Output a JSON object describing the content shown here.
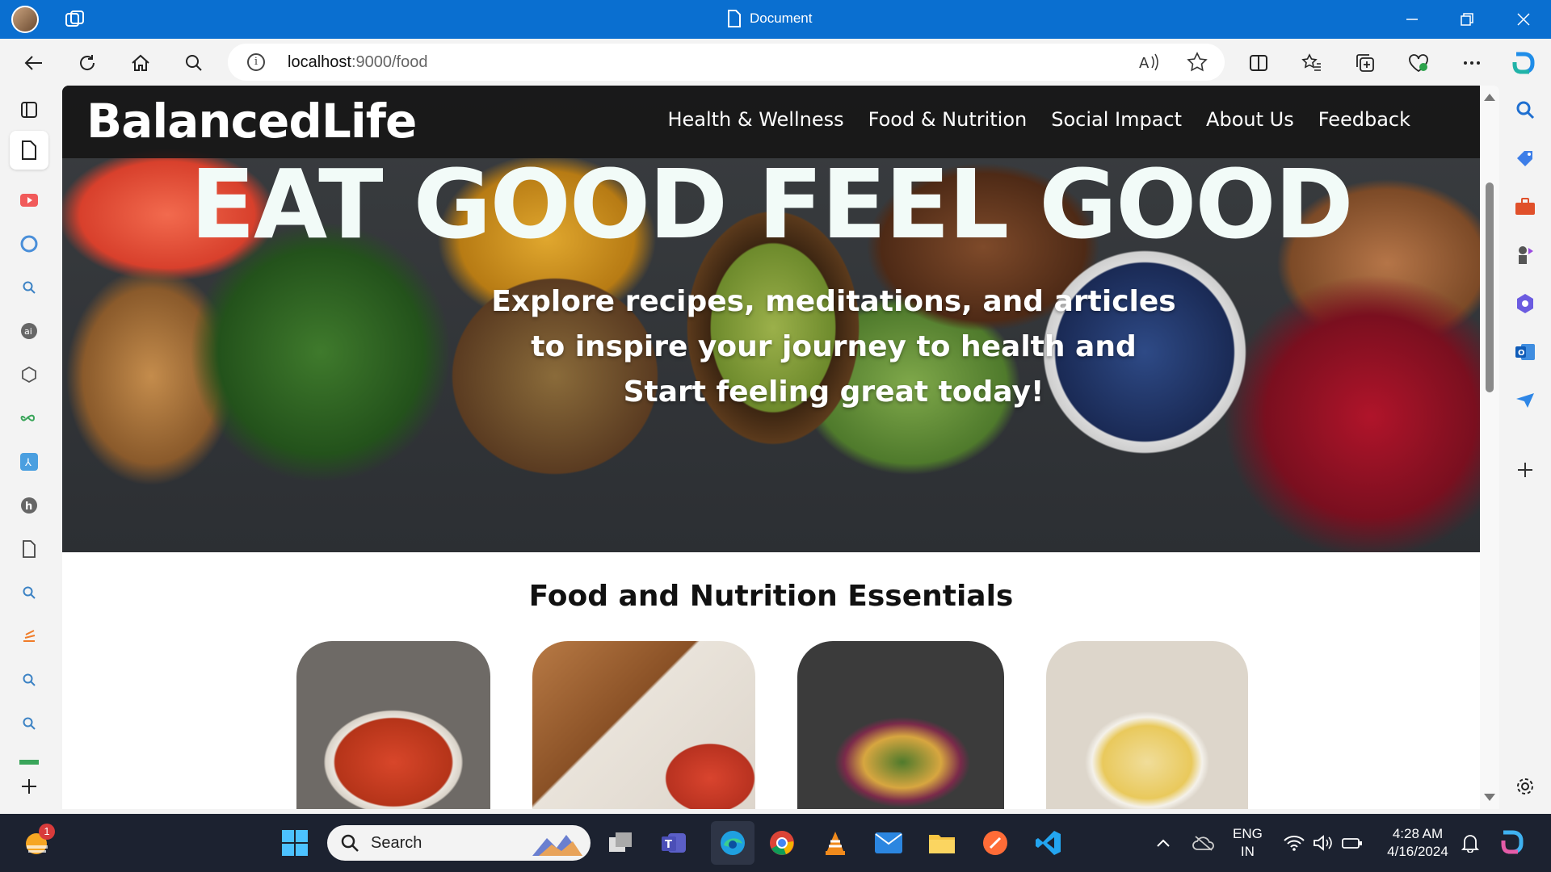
{
  "window": {
    "title": "Document"
  },
  "browser": {
    "url_host": "localhost",
    "url_rest": ":9000/food"
  },
  "site": {
    "logo": "BalancedLife",
    "nav": [
      "Health & Wellness",
      "Food & Nutrition",
      "Social Impact",
      "About Us",
      "Feedback"
    ],
    "hero_title": "EAT GOOD FEEL GOOD",
    "hero_subtitle_lines": [
      "Explore recipes, meditations, and articles",
      "to inspire your journey to health and",
      "Start feeling great today!"
    ],
    "section_title": "Food and Nutrition Essentials"
  },
  "taskbar": {
    "search_label": "Search",
    "lang_line1": "ENG",
    "lang_line2": "IN",
    "time": "4:28 AM",
    "date": "4/16/2024",
    "notification_badge": "1"
  },
  "colors": {
    "titlebar": "#0a6fd0",
    "page_nav_bg": "#141414",
    "taskbar": "#1c2230"
  },
  "icons": {
    "left_sidebar": [
      "workspaces-icon",
      "document-icon",
      "youtube-icon",
      "refresh-app-icon",
      "search-icon",
      "ai-icon",
      "settings-cube-icon",
      "infinity-icon",
      "app-icon",
      "h-icon",
      "file-icon",
      "search-icon",
      "stack-icon",
      "search-icon",
      "search-icon",
      "ruler-icon",
      "add-icon"
    ],
    "right_sidebar": [
      "search-icon",
      "tag-icon",
      "briefcase-icon",
      "chess-icon",
      "copilot-icon",
      "outlook-icon",
      "send-icon",
      "add-icon",
      "settings-icon"
    ]
  }
}
